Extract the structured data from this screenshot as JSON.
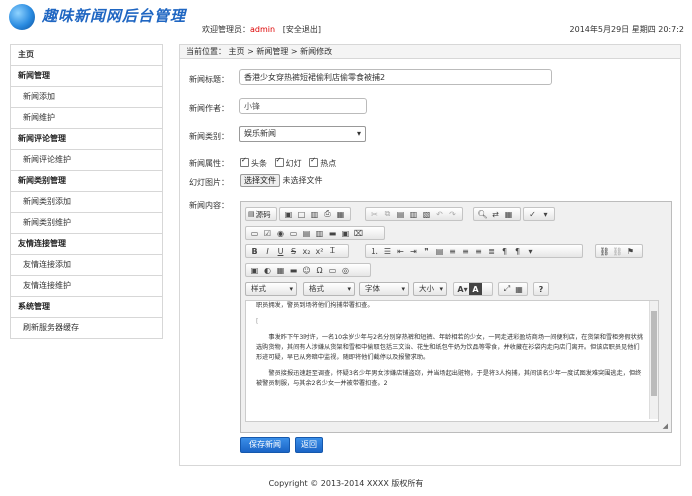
{
  "header": {
    "logo_text": "趣味新闻网后台管理",
    "welcome_label": "欢迎管理员：",
    "username": "admin",
    "logout": "[安全退出]",
    "datetime": "2014年5月29日 星期四 20:7:2"
  },
  "sidebar": {
    "home": "主页",
    "groups": [
      {
        "title": "新闻管理",
        "items": [
          "新闻添加",
          "新闻维护"
        ]
      },
      {
        "title": "新闻评论管理",
        "items": [
          "新闻评论维护"
        ]
      },
      {
        "title": "新闻类别管理",
        "items": [
          "新闻类别添加",
          "新闻类别维护"
        ]
      },
      {
        "title": "友情连接管理",
        "items": [
          "友情连接添加",
          "友情连接维护"
        ]
      },
      {
        "title": "系统管理",
        "items": [
          "刷新服务器缓存"
        ]
      }
    ]
  },
  "breadcrumb": "当前位置： 主页 > 新闻管理 > 新闻修改",
  "form": {
    "title_label": "新闻标题：",
    "title_value": "香港少女穿热裤短裙偷利店偷零食被捕2",
    "author_label": "新闻作者：",
    "author_value": "小锋",
    "category_label": "新闻类别：",
    "category_value": "娱乐新闻",
    "attr_label": "新闻属性：",
    "attrs": [
      "头条",
      "幻灯",
      "热点"
    ],
    "image_label": "幻灯图片：",
    "file_button": "选择文件",
    "file_status": "未选择文件",
    "content_label": "新闻内容：",
    "save_button": "保存新闻",
    "back_button": "返回"
  },
  "editor": {
    "source_label": "源码",
    "combos": [
      "样式",
      "格式",
      "字体",
      "大小"
    ],
    "paragraphs": [
      "职员拥发，警员到场将他们拘捕带署扣查。",
      "[",
      "事发昨下午3时许，一名10余岁少年与2名分别穿热裤和短裤、年龄相若的少女，一同走进彩盈坊商场一间便利店，在货架和雪柜旁假状挑选购货物，其间有人涉嫌从货架和雪柜中偷取包括三文治、花生和纸包牛奶为饮品等零食，并收藏在衫袋内走向店门离开。但该店职员见他们形迹可疑，早已从旁暗中监视，随即将他们截停以及报警求助。",
      "警员接报迅速赶至调查，怀疑3名少年男女涉嫌店铺盗窃，并当场起出赃物，于是将3人拘捕，其间该名少年一度试图发难突围逃走，但终被警员制服，与其余2名少女一并被带署扣查。2"
    ]
  },
  "footer": "Copyright © 2013-2014 XXXX 版权所有"
}
